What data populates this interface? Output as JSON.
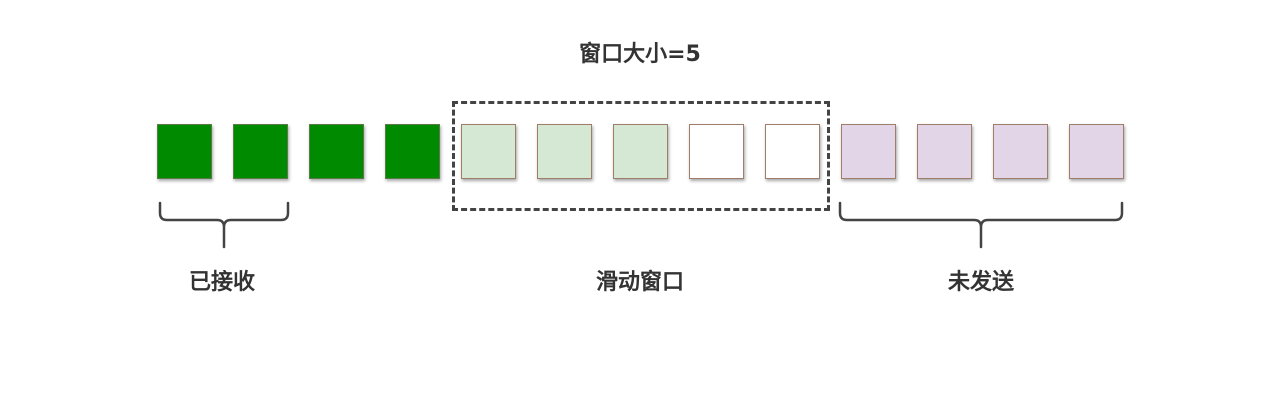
{
  "title": "窗口大小=5",
  "cells": [
    {
      "state": "received"
    },
    {
      "state": "received"
    },
    {
      "state": "received"
    },
    {
      "state": "received"
    },
    {
      "state": "window_sent"
    },
    {
      "state": "window_sent"
    },
    {
      "state": "window_sent"
    },
    {
      "state": "window_empty"
    },
    {
      "state": "window_empty"
    },
    {
      "state": "unsent"
    },
    {
      "state": "unsent"
    },
    {
      "state": "unsent"
    },
    {
      "state": "unsent"
    }
  ],
  "colors": {
    "received": "#008a00",
    "window_sent": "#d5e8d4",
    "window_empty": "#ffffff",
    "unsent": "#e1d5e7",
    "cell_border": "#9e7d6b",
    "brace": "#444444",
    "text": "#333333"
  },
  "labels": {
    "received": "已接收",
    "window": "滑动窗口",
    "unsent": "未发送"
  }
}
